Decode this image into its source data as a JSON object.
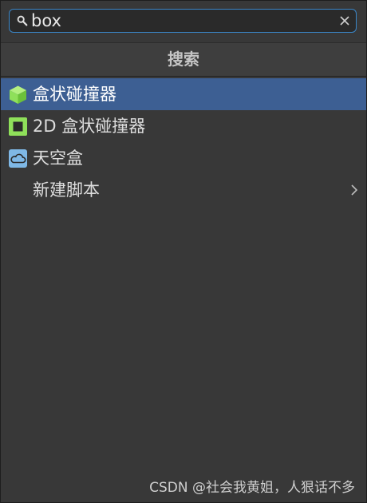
{
  "search": {
    "value": "box",
    "placeholder": ""
  },
  "header": {
    "title": "搜索"
  },
  "items": [
    {
      "label": "盒状碰撞器",
      "icon": "cube-icon",
      "selected": true
    },
    {
      "label": "2D 盒状碰撞器",
      "icon": "box-collider-2d-icon",
      "selected": false
    },
    {
      "label": "天空盒",
      "icon": "cloud-icon",
      "selected": false
    },
    {
      "label": "新建脚本",
      "icon": "",
      "has_submenu": true,
      "selected": false
    }
  ],
  "watermark": "CSDN @社会我黄姐，人狠话不多",
  "colors": {
    "selection": "#3d5f93",
    "search_border": "#3a86c8",
    "panel_bg": "#383838",
    "cube_green": "#8fe05a",
    "cloud_blue": "#7fb8e6"
  }
}
